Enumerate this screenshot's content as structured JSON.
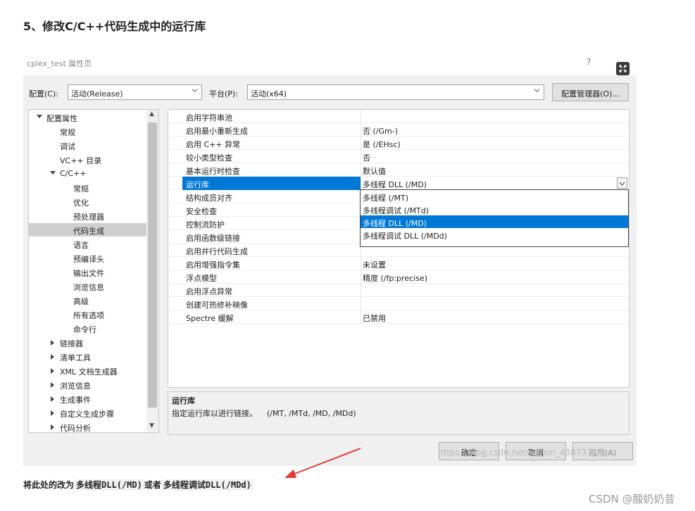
{
  "heading": "5、修改C/C++代码生成中的运行库",
  "window": {
    "title": "cplex_test 属性页",
    "help": "?"
  },
  "toolbar": {
    "config_label": "配置(C):",
    "config_value": "活动(Release)",
    "platform_label": "平台(P):",
    "platform_value": "活动(x64)",
    "config_manager": "配置管理器(O)..."
  },
  "tree": [
    "配置属性",
    "常规",
    "调试",
    "VC++ 目录",
    "C/C++",
    "常规",
    "优化",
    "预处理器",
    "代码生成",
    "语言",
    "预编译头",
    "输出文件",
    "浏览信息",
    "高级",
    "所有选项",
    "命令行",
    "链接器",
    "清单工具",
    "XML 文档生成器",
    "浏览信息",
    "生成事件",
    "自定义生成步骤",
    "代码分析"
  ],
  "grid": {
    "names": [
      "启用字符串池",
      "启用最小重新生成",
      "启用 C++ 异常",
      "较小类型检查",
      "基本运行时检查",
      "运行库",
      "结构成员对齐",
      "安全检查",
      "控制流防护",
      "启用函数级链接",
      "启用并行代码生成",
      "启用增强指令集",
      "浮点模型",
      "启用浮点异常",
      "创建可热修补映像",
      "Spectre 缓解"
    ],
    "values": [
      "",
      "否 (/Gm-)",
      "是 (/EHsc)",
      "否",
      "默认值",
      "多线程 DLL (/MD)",
      "",
      "",
      "",
      "",
      "",
      "未设置",
      "精度 (/fp:precise)",
      "",
      "",
      "已禁用"
    ]
  },
  "dropdown": [
    "多线程 (/MT)",
    "多线程调试 (/MTd)",
    "多线程 DLL (/MD)",
    "多线程调试 DLL (/MDd)"
  ],
  "description": {
    "title": "运行库",
    "text": "指定运行库以进行链接。    (/MT, /MTd, /MD, /MDd)"
  },
  "buttons": {
    "ok": "确定",
    "cancel": "取消",
    "apply": "应用(A)"
  },
  "watermark": "https://blog.csdn.net/weixin_43873744",
  "caption": {
    "pre": "将此处的改为",
    "code1": "多线程DLL(/MD)",
    "mid": "或者",
    "code2": "多线程调试DLL(/MDd)"
  },
  "site": "CSDN @酸奶奶昔",
  "colors": {
    "selection": "#0078d7",
    "annotation_arrow": "#e53935"
  }
}
